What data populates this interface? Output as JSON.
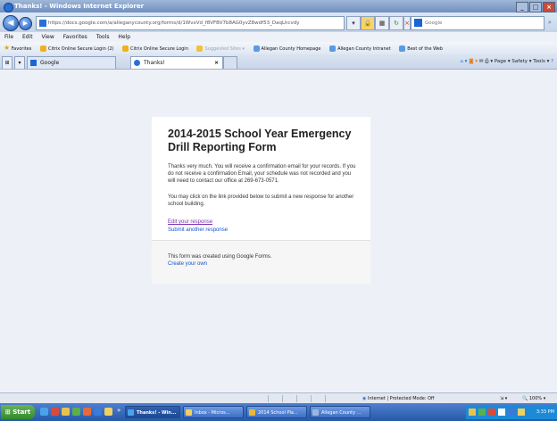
{
  "window": {
    "title": "Thanks! - Windows Internet Explorer",
    "min": "_",
    "max": "□",
    "close": "×"
  },
  "address": {
    "url": "https://docs.google.com/a/alleganycounty.org/forms/d/1WvxVd_f8VFBV7b8AG0yvZ8wdf53_DaqLhcvdy",
    "search_placeholder": "Google"
  },
  "menu": [
    "File",
    "Edit",
    "View",
    "Favorites",
    "Tools",
    "Help"
  ],
  "favorites": {
    "label": "Favorites",
    "items": [
      "Citrix Online Secure Login (2)",
      "Citrix Online Secure Login",
      "Suggested Sites ▾",
      "Allegan County Homepage",
      "Allegan County Intranet",
      "Best of the Web"
    ]
  },
  "tabs": [
    {
      "label": "Google"
    },
    {
      "label": "Thanks!"
    }
  ],
  "commandbar": "Page ▾  Safety ▾  Tools ▾",
  "form": {
    "title": "2014-2015 School Year Emergency Drill Reporting Form",
    "message1": "Thanks very much. You will receive a confirmation email for your records. If you do not receive a confirmation Email, your schedule was not recorded and you will need to contact our office at 269-673-0571.",
    "message2": "You may click on the link provided below to submit a new response for another school building.",
    "edit_link": "Edit your response",
    "submit_link": "Submit another response",
    "footer_text": "This form was created using Google Forms.",
    "create_link": "Create your own"
  },
  "status": {
    "zone": "Internet | Protected Mode: Off",
    "zoom": "100% ▾"
  },
  "taskbar": {
    "start": "Start",
    "tasks": [
      "Thanks! - Win...",
      "Inbox - Micros...",
      "2014 School Pla...",
      "Allegan County ..."
    ],
    "clock": "3:33 PM"
  },
  "colors": {
    "link": "#1155cc",
    "visited_link": "#7b2fb0",
    "background": "#edf1f7"
  }
}
